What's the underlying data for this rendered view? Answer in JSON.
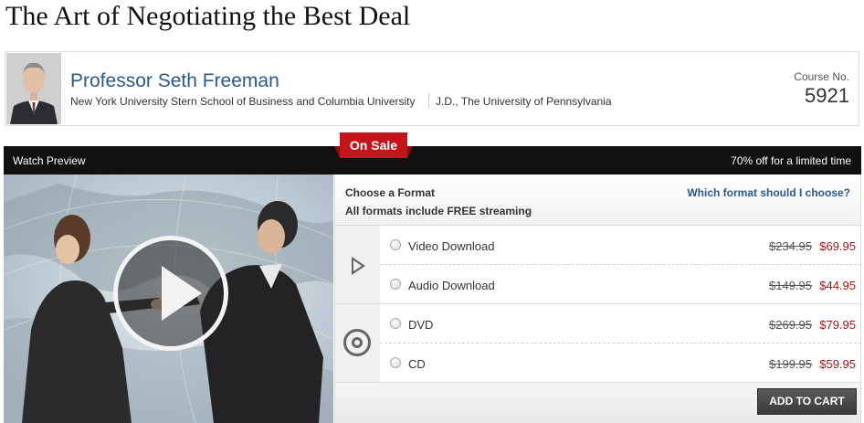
{
  "course": {
    "title": "The Art of Negotiating the Best Deal"
  },
  "professor": {
    "name": "Professor Seth Freeman",
    "institution": "New York University Stern School of Business and Columbia University",
    "degree": "J.D., The University of Pennsylvania"
  },
  "course_number": {
    "label": "Course No.",
    "value": "5921"
  },
  "sale_badge": "On Sale",
  "bar": {
    "watch_label": "Watch Preview",
    "offer_text": "70% off for a limited time"
  },
  "format_panel": {
    "title": "Choose a Format",
    "subtitle": "All formats include FREE streaming",
    "help_link": "Which format should I choose?",
    "groups": [
      {
        "icon": "play-outline-icon",
        "options": [
          {
            "label": "Video Download",
            "original_price": "$234.95",
            "sale_price": "$69.95"
          },
          {
            "label": "Audio Download",
            "original_price": "$149.95",
            "sale_price": "$44.95"
          }
        ]
      },
      {
        "icon": "disc-icon",
        "options": [
          {
            "label": "DVD",
            "original_price": "$269.95",
            "sale_price": "$79.95"
          },
          {
            "label": "CD",
            "original_price": "$199.95",
            "sale_price": "$59.95"
          }
        ]
      }
    ],
    "add_to_cart": "ADD TO CART"
  },
  "colors": {
    "link_blue": "#2b5a8a",
    "sale_red": "#c3161c",
    "price_red": "#a3161a",
    "bar_black": "#111111"
  }
}
